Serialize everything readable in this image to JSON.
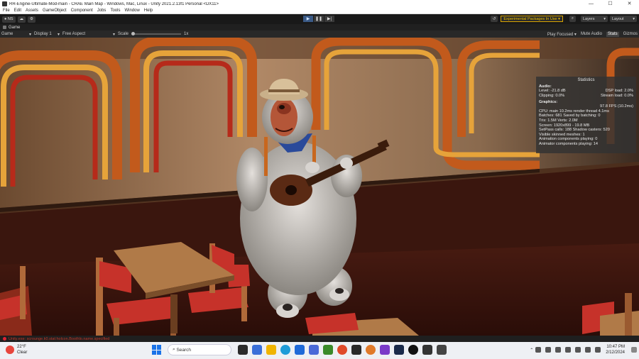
{
  "window": {
    "title": "RR-Engine-Ultimate-Mod-main - CRAE Main Map - Windows, Mac, Linux - Unity 2021.2.13f1 Personal <DX11>",
    "minimize": "—",
    "maximize": "☐",
    "close": "✕"
  },
  "menu": [
    "File",
    "Edit",
    "Assets",
    "GameObject",
    "Component",
    "Jobs",
    "Tools",
    "Window",
    "Help"
  ],
  "toolbar": {
    "account": "NS",
    "packages_label": "Experimental Packages In Use",
    "layers_label": "Layers",
    "layout_label": "Layout"
  },
  "tab": {
    "game": "Game"
  },
  "gamebar": {
    "view": "Game",
    "display": "Display 1",
    "aspect": "Free Aspect",
    "scale_label": "Scale",
    "scale_value": "1x",
    "play_focused": "Play Focused",
    "mute_audio": "Mute Audio",
    "stats": "Stats",
    "gizmos": "Gizmos"
  },
  "stats": {
    "title": "Statistics",
    "audio_header": "Audio:",
    "level": "Level: -21.8 dB",
    "dsp_load": "DSP load: 2.0%",
    "clipping": "Clipping: 0.0%",
    "stream_load": "Stream load: 0.0%",
    "graphics_header": "Graphics:",
    "fps": "97.8 FPS (10.2ms)",
    "cpu": "CPU: main 10.2ms  render thread 4.1ms",
    "batches": "Batches: 681    Saved by batching: 0",
    "tris": "Tris: 1.5M         Verts: 2.0M",
    "screen": "Screen: 1920x899 - 19.8 MB",
    "setpass": "SetPass calls: 188       Shadow casters: 520",
    "skinned": "Visible skinned meshes: 1",
    "anim": "Animation components playing: 0",
    "animator": "Animator components playing: 14"
  },
  "status": {
    "error": "Unity.exe: scrounge.k0.stat:holcon.Boothlo.name.specified"
  },
  "taskbar": {
    "temp": "22°F",
    "weather": "Clear",
    "search": "Search",
    "time": "10:47 PM",
    "date": "2/12/2024"
  }
}
